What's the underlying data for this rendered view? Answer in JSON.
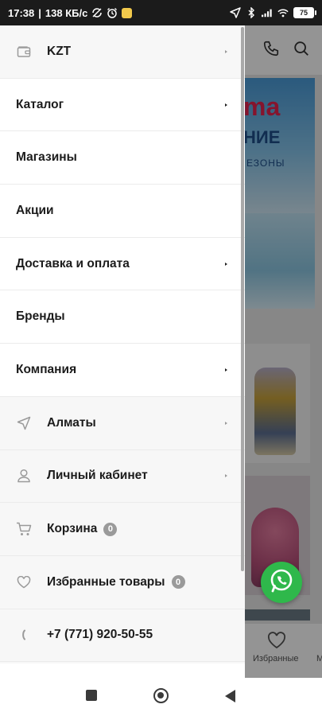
{
  "status_bar": {
    "time": "17:38",
    "speed": "138 КБ/с",
    "battery": "75"
  },
  "background_app": {
    "banner_brand": "ma",
    "banner_sub": "НИЕ",
    "banner_sub2": "ЕЗОНЫ",
    "bottom_nav_favorites": "Избранные",
    "bottom_nav_more": "М"
  },
  "drawer": {
    "items": [
      {
        "label": "KZT",
        "icon": "wallet-icon",
        "has_arrow": true
      },
      {
        "label": "Каталог",
        "has_arrow": true
      },
      {
        "label": "Магазины",
        "has_arrow": false
      },
      {
        "label": "Акции",
        "has_arrow": false
      },
      {
        "label": "Доставка и оплата",
        "has_arrow": true
      },
      {
        "label": "Бренды",
        "has_arrow": false
      },
      {
        "label": "Компания",
        "has_arrow": true
      },
      {
        "label": "Алматы",
        "icon": "location-arrow-icon",
        "has_arrow": true
      },
      {
        "label": "Личный кабинет",
        "icon": "user-icon",
        "has_arrow": true
      },
      {
        "label": "Корзина",
        "icon": "cart-icon",
        "badge": "0"
      },
      {
        "label": "Избранные товары",
        "icon": "heart-icon",
        "badge": "0"
      },
      {
        "label": "+7 (771) 920-50-55",
        "icon": "phone-icon"
      }
    ]
  },
  "colors": {
    "accent_gray": "#9a9a9a",
    "whatsapp_green": "#2fb84b",
    "status_bar": "#1b1b1b"
  }
}
